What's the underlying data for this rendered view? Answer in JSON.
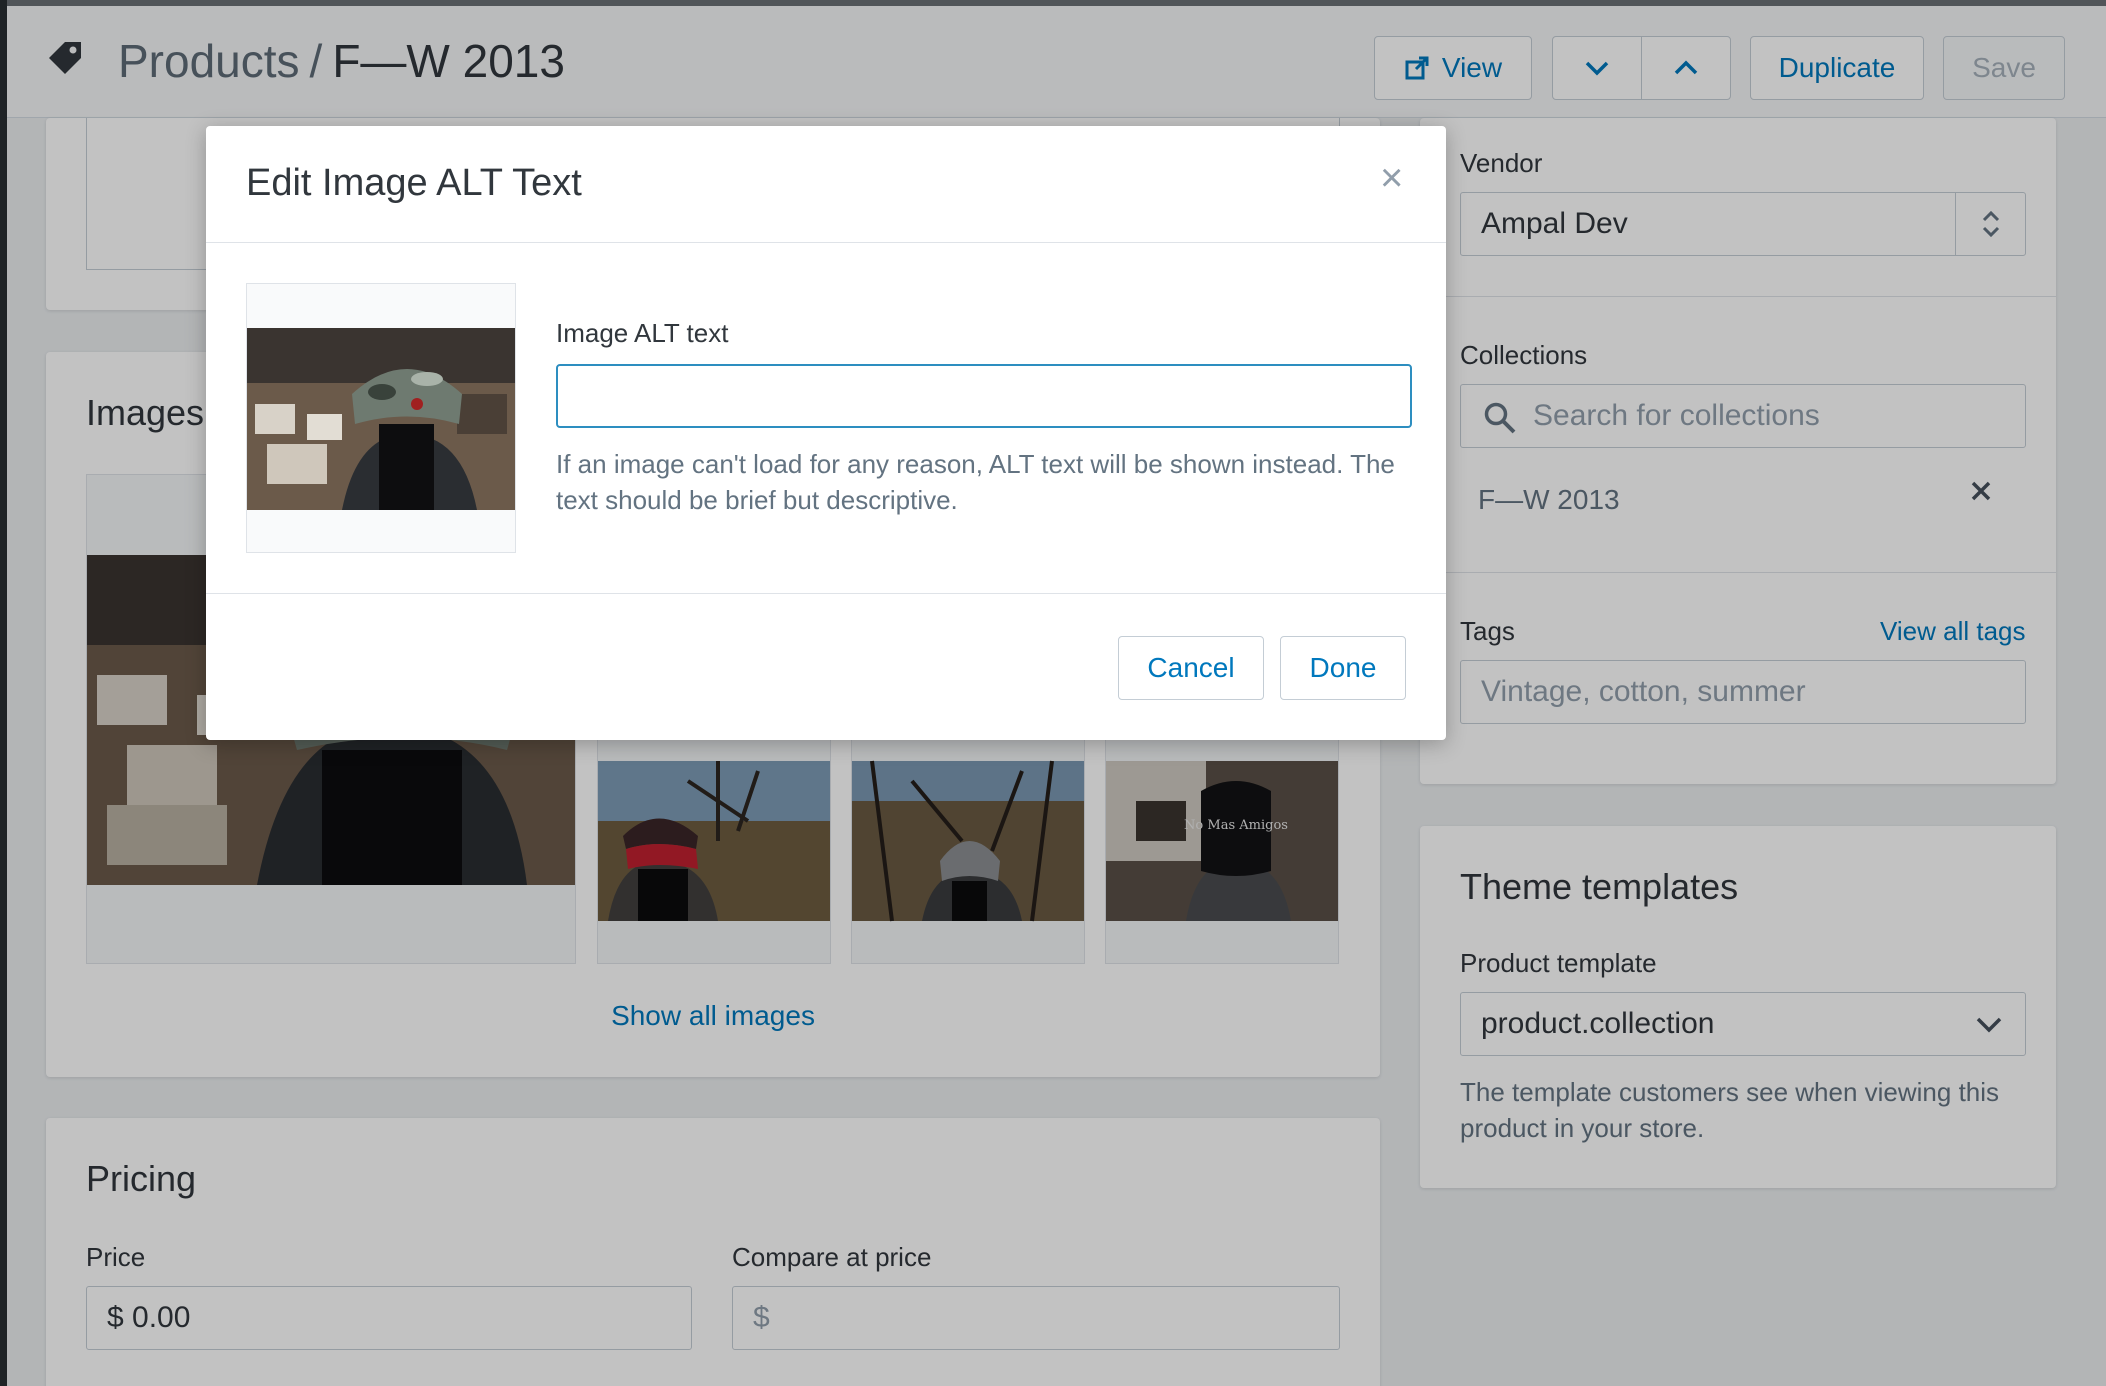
{
  "header": {
    "breadcrumb_parent": "Products",
    "breadcrumb_separator": "/",
    "title": "F—W 2013",
    "view_label": "View",
    "duplicate_label": "Duplicate",
    "save_label": "Save"
  },
  "images_section": {
    "title": "Images",
    "show_all_label": "Show all images",
    "thumbnails": [
      {
        "name": "red-cap-photo"
      },
      {
        "name": "grey-cap-photo"
      },
      {
        "name": "black-cap-photo",
        "cap_text": "No Mas Amigos"
      }
    ]
  },
  "pricing": {
    "title": "Pricing",
    "price_label": "Price",
    "price_value": "$ 0.00",
    "compare_label": "Compare at price",
    "compare_placeholder": "$"
  },
  "organization": {
    "vendor_label": "Vendor",
    "vendor_value": "Ampal Dev",
    "collections_label": "Collections",
    "collections_search_placeholder": "Search for collections",
    "collection_items": [
      "F—W 2013"
    ],
    "tags_label": "Tags",
    "view_all_tags_label": "View all tags",
    "tags_placeholder": "Vintage, cotton, summer"
  },
  "theme_templates": {
    "title": "Theme templates",
    "product_template_label": "Product template",
    "product_template_value": "product.collection",
    "help_text": "The template customers see when viewing this product in your store."
  },
  "modal": {
    "title": "Edit Image ALT Text",
    "close_symbol": "×",
    "field_label": "Image ALT text",
    "field_value": "",
    "help_text": "If an image can't load for any reason, ALT text will be shown instead. The text should be brief but descriptive.",
    "cancel_label": "Cancel",
    "done_label": "Done"
  },
  "colors": {
    "accent": "#0078bd",
    "focus_border": "#2d8ec0",
    "text": "#31373d",
    "muted_text": "#637381"
  },
  "icons": {
    "header": "tag-icon",
    "view": "external-link-icon",
    "prev": "chevron-down-icon",
    "next": "chevron-up-icon",
    "vendor_select": "up-down-arrows-icon",
    "collections_search": "search-icon",
    "remove_collection": "close-icon",
    "template_select": "chevron-down-icon"
  }
}
